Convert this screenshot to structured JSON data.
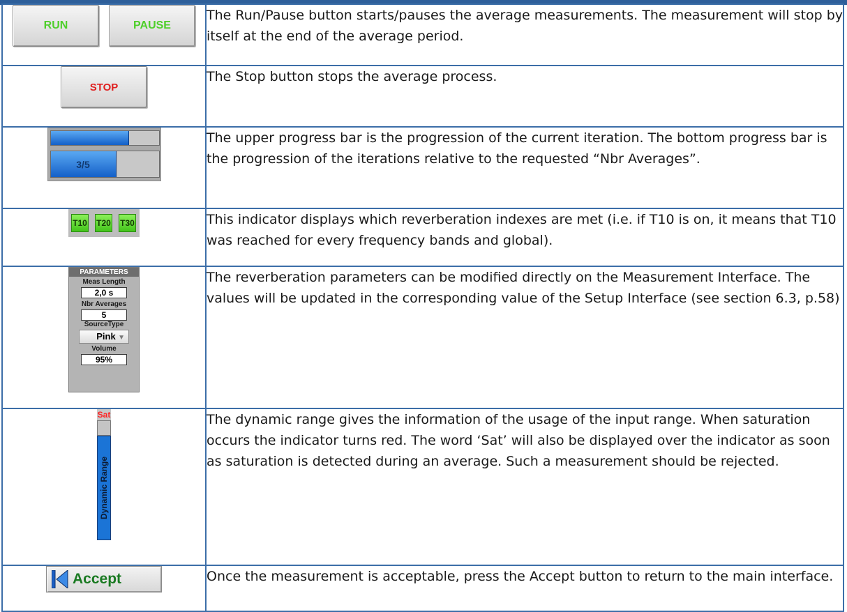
{
  "rows": [
    {
      "buttons": [
        "RUN",
        "PAUSE"
      ],
      "text": "The Run/Pause button starts/pauses the average measurements. The measurement will stop by itself at the end of the average period."
    },
    {
      "buttons": [
        "STOP"
      ],
      "text": "The Stop button stops the average process."
    },
    {
      "progress": {
        "upper_fraction": 0.72,
        "lower_fraction": 0.6,
        "lower_label": "3/5"
      },
      "text": "The upper progress bar is the progression of the current iteration. The bottom progress bar is the progression of the iterations relative to the requested “Nbr Averages”."
    },
    {
      "indicators": [
        "T10",
        "T20",
        "T30"
      ],
      "text": "This indicator displays which reverberation indexes are met (i.e. if T10 is on, it means that T10 was reached for every frequency bands and global)."
    },
    {
      "parameters": {
        "title": "PARAMETERS",
        "meas_length_label": "Meas Length",
        "meas_length_value": "2,0 s",
        "nbr_averages_label": "Nbr Averages",
        "nbr_averages_value": "5",
        "source_type_label": "SourceType",
        "source_type_value": "Pink",
        "volume_label": "Volume",
        "volume_value": "95%"
      },
      "text": "The reverberation parameters can be modified directly on the Measurement Interface. The values will be updated in the corresponding value of the Setup Interface (see section 6.3, p.58)"
    },
    {
      "dynamic_range": {
        "sat_label": "Sat",
        "label": "Dynamic Range"
      },
      "text": "The dynamic range gives the information of the usage of the input range. When saturation occurs the indicator turns red. The word ‘Sat’ will also be displayed over the indicator as soon as saturation is detected during an average. Such a measurement should be rejected."
    },
    {
      "accept_label": "Accept",
      "text": "Once the measurement is acceptable, press the Accept button to return to the main interface."
    }
  ],
  "colors": {
    "border": "#3c6ea8",
    "green_text": "#4ecf2a",
    "red_text": "#e02020",
    "progress_blue": "#1460c8"
  }
}
